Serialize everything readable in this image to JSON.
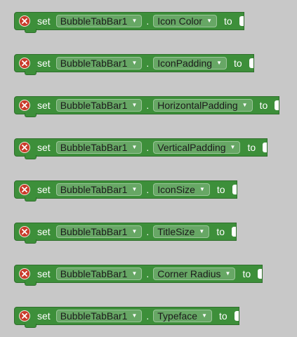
{
  "blocks": [
    {
      "set_label": "set",
      "component": "BubbleTabBar1",
      "dot": ".",
      "property": "Icon Color",
      "to_label": "to"
    },
    {
      "set_label": "set",
      "component": "BubbleTabBar1",
      "dot": ".",
      "property": "IconPadding",
      "to_label": "to"
    },
    {
      "set_label": "set",
      "component": "BubbleTabBar1",
      "dot": ".",
      "property": "HorizontalPadding",
      "to_label": "to"
    },
    {
      "set_label": "set",
      "component": "BubbleTabBar1",
      "dot": ".",
      "property": "VerticalPadding",
      "to_label": "to"
    },
    {
      "set_label": "set",
      "component": "BubbleTabBar1",
      "dot": ".",
      "property": "IconSize",
      "to_label": "to"
    },
    {
      "set_label": "set",
      "component": "BubbleTabBar1",
      "dot": ".",
      "property": "TitleSize",
      "to_label": "to"
    },
    {
      "set_label": "set",
      "component": "BubbleTabBar1",
      "dot": ".",
      "property": "Corner Radius",
      "to_label": "to"
    },
    {
      "set_label": "set",
      "component": "BubbleTabBar1",
      "dot": ".",
      "property": "Typeface",
      "to_label": "to"
    }
  ],
  "icons": {
    "error": "error-x-icon",
    "dropdown": "chevron-down-icon"
  },
  "colors": {
    "block_fill": "#3d8f3a",
    "error_badge": "#c93b2a"
  }
}
